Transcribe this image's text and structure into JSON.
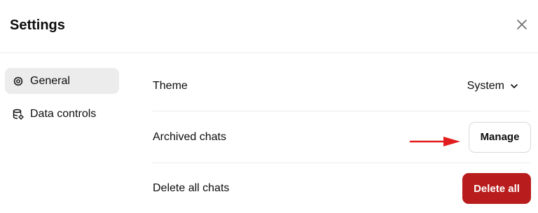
{
  "dialog": {
    "title": "Settings",
    "close_icon": "close-icon"
  },
  "sidebar": {
    "items": [
      {
        "label": "General",
        "icon": "gear-icon",
        "active": true
      },
      {
        "label": "Data controls",
        "icon": "database-settings-icon",
        "active": false
      }
    ]
  },
  "settings": {
    "theme": {
      "label": "Theme",
      "value": "System",
      "icon": "chevron-down-icon"
    },
    "archived": {
      "label": "Archived chats",
      "button": "Manage"
    },
    "delete": {
      "label": "Delete all chats",
      "button": "Delete all"
    }
  },
  "annotation": {
    "icon": "arrow-right-icon",
    "color": "#e11d1d"
  },
  "colors": {
    "danger": "#b91c1c",
    "active_nav_bg": "#ececec",
    "divider": "#ececec"
  }
}
